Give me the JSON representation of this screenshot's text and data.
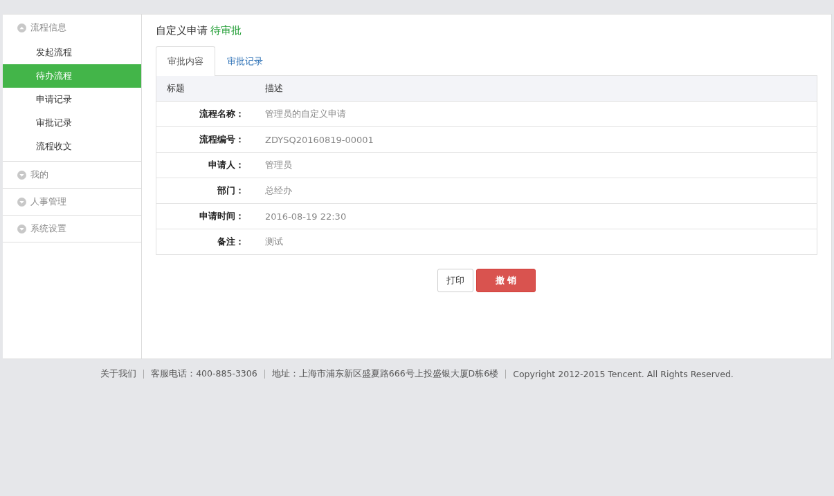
{
  "sidebar": {
    "groups": [
      {
        "title": "流程信息",
        "expanded": true,
        "items": [
          {
            "label": "发起流程",
            "selected": false
          },
          {
            "label": "待办流程",
            "selected": true
          },
          {
            "label": "申请记录",
            "selected": false
          },
          {
            "label": "审批记录",
            "selected": false
          },
          {
            "label": "流程收文",
            "selected": false
          }
        ]
      },
      {
        "title": "我的",
        "expanded": false
      },
      {
        "title": "人事管理",
        "expanded": false
      },
      {
        "title": "系统设置",
        "expanded": false
      }
    ]
  },
  "page": {
    "title": "自定义申请",
    "status": "待审批"
  },
  "tabs": [
    {
      "label": "审批内容",
      "selected": true
    },
    {
      "label": "审批记录",
      "selected": false
    }
  ],
  "table": {
    "columns": [
      "标题",
      "描述"
    ],
    "rows": [
      {
        "label": "流程名称：",
        "value": "管理员的自定义申请"
      },
      {
        "label": "流程编号：",
        "value": "ZDYSQ20160819-00001"
      },
      {
        "label": "申请人：",
        "value": "管理员"
      },
      {
        "label": "部门：",
        "value": "总经办"
      },
      {
        "label": "申请时间：",
        "value": "2016-08-19 22:30"
      },
      {
        "label": "备注：",
        "value": "测试"
      }
    ]
  },
  "buttons": [
    {
      "label": "打印",
      "kind": "default"
    },
    {
      "label": "撤 销",
      "kind": "danger"
    }
  ],
  "footer": [
    "关于我们",
    "客服电话：400-885-3306",
    "地址：上海市浦东新区盛夏路666号上投盛银大厦D栋6楼",
    "Copyright 2012-2015 Tencent. All Rights Reserved."
  ]
}
